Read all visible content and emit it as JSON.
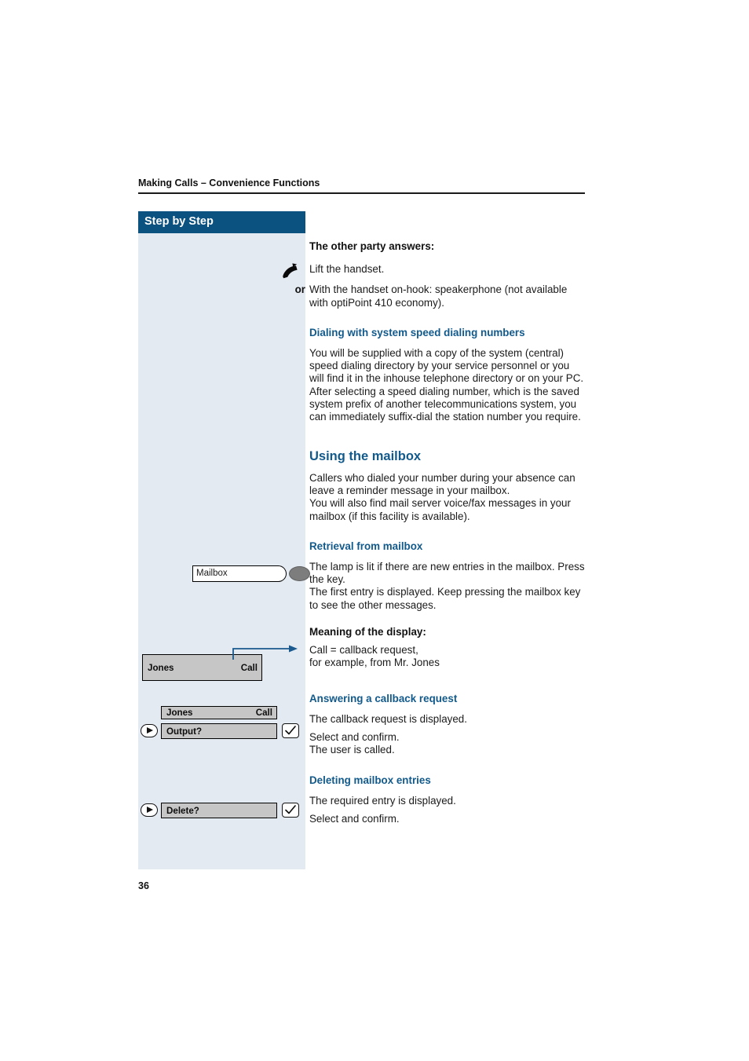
{
  "page": {
    "running_header": "Making Calls – Convenience Functions",
    "folio": "36",
    "accent_blue": "#125a8c",
    "header_bar_blue": "#0c5280",
    "sidebar_blue": "#e4eaf2",
    "display_gray": "#c6c6c6"
  },
  "sidebar": {
    "title": "Step by Step"
  },
  "content": {
    "sec_other_party_heading": "The other party answers:",
    "lift_handset_text": "Lift the handset.",
    "or_label": "or",
    "speakerphone_text": "With the handset on-hook: speakerphone (not available with optiPoint 410 economy).",
    "sec_speed_dial_heading": "Dialing with system speed dialing numbers",
    "speed_dial_p1": "You will be supplied with a copy of the system (central) speed dialing directory by your service personnel or you will find it in the inhouse telephone directory or on your PC.",
    "speed_dial_p2": "After selecting a speed dialing number, which is the saved system prefix of another telecommunications system, you can immediately suffix-dial the station number you require.",
    "sec_mailbox_heading": "Using the mailbox",
    "mailbox_p1": "Callers who dialed your number during your absence can leave a reminder message in your mailbox.",
    "mailbox_p2": "You will also find mail server voice/fax messages in your mailbox (if this facility is available).",
    "sec_retrieval_heading": "Retrieval from mailbox",
    "retrieval_p1": "The lamp is lit if there are new entries in the mailbox. Press the key.",
    "retrieval_p2": "The first entry is displayed. Keep pressing the mailbox key to see the other messages.",
    "sec_meaning_heading": "Meaning of the display:",
    "meaning_p1": "Call = callback request,",
    "meaning_p2": "for example, from Mr. Jones",
    "sec_answering_heading": "Answering a callback request",
    "answering_p1": "The callback request is displayed.",
    "answering_p2": "Select and confirm.",
    "answering_p3": "The user is called.",
    "sec_deleting_heading": "Deleting mailbox entries",
    "deleting_p1": "The required entry is displayed.",
    "deleting_p2": "Select and confirm."
  },
  "graphics": {
    "mailbox_key": {
      "label": "Mailbox",
      "lamp_color": "#7d7d7d"
    },
    "display_jones_call": {
      "left": "Jones",
      "right": "Call"
    },
    "answering_group": {
      "display_left": "Jones",
      "display_right": "Call",
      "option_label": "Output?"
    },
    "deleting_group": {
      "option_label": "Delete?"
    }
  }
}
